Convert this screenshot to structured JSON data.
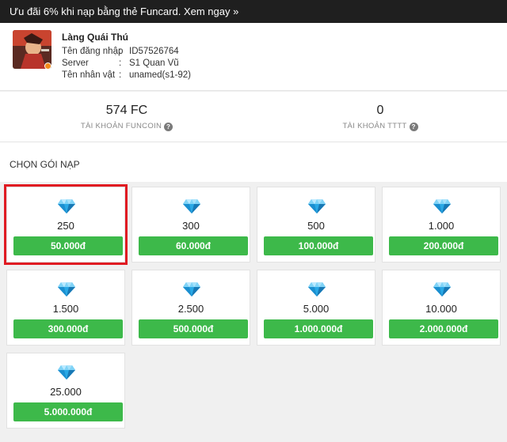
{
  "promo": {
    "text": "Ưu đãi 6% khi nạp bằng thẻ Funcard. Xem ngay »"
  },
  "profile": {
    "game_name": "Làng Quái Thú",
    "rows": [
      {
        "label": "Tên đăng nhập",
        "value": "ID57526764"
      },
      {
        "label": "Server",
        "value": "S1 Quan Vũ"
      },
      {
        "label": "Tên nhân vật",
        "value": "unamed(s1-92)"
      }
    ]
  },
  "balances": {
    "funcoin": {
      "amount": "574 FC",
      "label": "TÀI KHOẢN FUNCOIN"
    },
    "tttt": {
      "amount": "0",
      "label": "TÀI KHOẢN TTTT"
    }
  },
  "section_title": "CHỌN GÓI NẠP",
  "packages": [
    {
      "amount": "250",
      "price": "50.000đ",
      "selected": true
    },
    {
      "amount": "300",
      "price": "60.000đ"
    },
    {
      "amount": "500",
      "price": "100.000đ"
    },
    {
      "amount": "1.000",
      "price": "200.000đ"
    },
    {
      "amount": "1.500",
      "price": "300.000đ"
    },
    {
      "amount": "2.500",
      "price": "500.000đ"
    },
    {
      "amount": "5.000",
      "price": "1.000.000đ"
    },
    {
      "amount": "10.000",
      "price": "2.000.000đ"
    },
    {
      "amount": "25.000",
      "price": "5.000.000đ"
    }
  ],
  "colors": {
    "accent": "#3db94a",
    "selected_border": "#e01b22",
    "promo_bg": "#1f1f1f"
  }
}
